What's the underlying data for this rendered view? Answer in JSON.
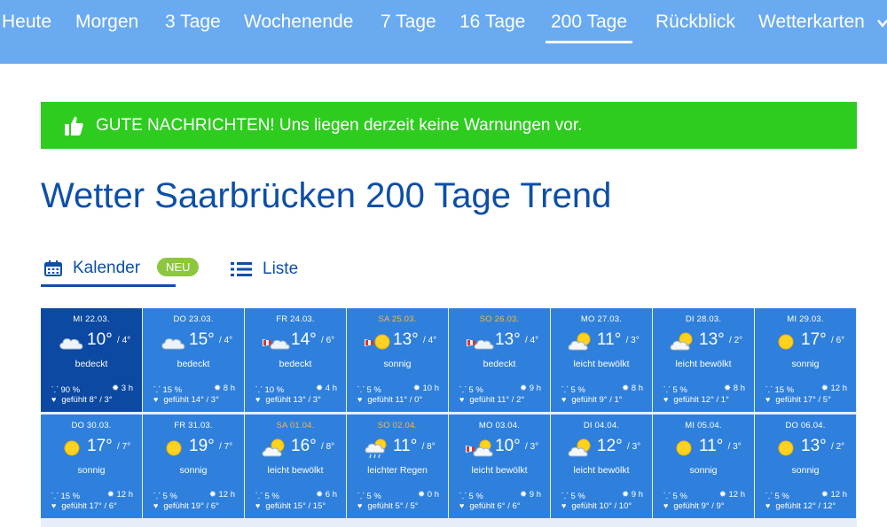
{
  "nav": {
    "items": [
      "Heute",
      "Morgen",
      "3 Tage",
      "Wochenende",
      "7 Tage",
      "16 Tage",
      "200 Tage",
      "Rückblick",
      "Wetterkarten"
    ],
    "active": "200 Tage"
  },
  "alert": {
    "message": "GUTE NACHRICHTEN! Uns liegen derzeit keine Warnungen vor."
  },
  "page": {
    "title": "Wetter Saarbrücken 200 Tage Trend"
  },
  "tabs": {
    "calendar": "Kalender",
    "calendar_badge": "NEU",
    "list": "Liste"
  },
  "colors": {
    "nav_bg": "#6aaaf0",
    "alert_bg": "#2ecc1f",
    "title": "#0d4fa8",
    "cell": "#2f80dc",
    "cell_today": "#0b49a3",
    "weekend_date": "#ffb53a"
  },
  "days": [
    {
      "date": "MI 22.03.",
      "weekend": false,
      "today": true,
      "icon": "cloudy-icon",
      "temp": "10°",
      "min": "/ 4°",
      "cond": "bedeckt",
      "rain": "90 %",
      "sun": "3 h",
      "felt": "gefühlt 8° / 3°"
    },
    {
      "date": "DO 23.03.",
      "weekend": false,
      "today": false,
      "icon": "cloudy-icon",
      "temp": "15°",
      "min": "/ 4°",
      "cond": "bedeckt",
      "rain": "15 %",
      "sun": "8 h",
      "felt": "gefühlt 14° / 3°"
    },
    {
      "date": "FR 24.03.",
      "weekend": false,
      "today": false,
      "icon": "windy-cloudy-icon",
      "temp": "14°",
      "min": "/ 6°",
      "cond": "bedeckt",
      "rain": "10 %",
      "sun": "4 h",
      "felt": "gefühlt 13° / 3°"
    },
    {
      "date": "SA 25.03.",
      "weekend": true,
      "today": false,
      "icon": "windy-sunny-icon",
      "temp": "13°",
      "min": "/ 4°",
      "cond": "sonnig",
      "rain": "5 %",
      "sun": "10 h",
      "felt": "gefühlt 11° / 0°"
    },
    {
      "date": "SO 26.03.",
      "weekend": true,
      "today": false,
      "icon": "windy-cloudy-icon",
      "temp": "13°",
      "min": "/ 4°",
      "cond": "bedeckt",
      "rain": "5 %",
      "sun": "9 h",
      "felt": "gefühlt 11° / 2°"
    },
    {
      "date": "MO 27.03.",
      "weekend": false,
      "today": false,
      "icon": "partly-cloudy-icon",
      "temp": "11°",
      "min": "/ 3°",
      "cond": "leicht bewölkt",
      "rain": "5 %",
      "sun": "8 h",
      "felt": "gefühlt 9° / 1°"
    },
    {
      "date": "DI 28.03.",
      "weekend": false,
      "today": false,
      "icon": "partly-cloudy-icon",
      "temp": "13°",
      "min": "/ 2°",
      "cond": "leicht bewölkt",
      "rain": "5 %",
      "sun": "8 h",
      "felt": "gefühlt 12° / 1°"
    },
    {
      "date": "MI 29.03.",
      "weekend": false,
      "today": false,
      "icon": "sun-icon",
      "temp": "17°",
      "min": "/ 6°",
      "cond": "sonnig",
      "rain": "15 %",
      "sun": "12 h",
      "felt": "gefühlt 17° / 5°"
    },
    {
      "date": "DO 30.03.",
      "weekend": false,
      "today": false,
      "icon": "sun-icon",
      "temp": "17°",
      "min": "/ 7°",
      "cond": "sonnig",
      "rain": "15 %",
      "sun": "12 h",
      "felt": "gefühlt 17° / 6°"
    },
    {
      "date": "FR 31.03.",
      "weekend": false,
      "today": false,
      "icon": "sun-icon",
      "temp": "19°",
      "min": "/ 7°",
      "cond": "sonnig",
      "rain": "5 %",
      "sun": "12 h",
      "felt": "gefühlt 19° / 6°"
    },
    {
      "date": "SA 01.04.",
      "weekend": true,
      "today": false,
      "icon": "partly-cloudy-icon",
      "temp": "16°",
      "min": "/ 8°",
      "cond": "leicht bewölkt",
      "rain": "5 %",
      "sun": "6 h",
      "felt": "gefühlt 15° / 15°"
    },
    {
      "date": "SO 02.04.",
      "weekend": true,
      "today": false,
      "icon": "light-rain-icon",
      "temp": "11°",
      "min": "/ 8°",
      "cond": "leichter Regen",
      "rain": "5 %",
      "sun": "0 h",
      "felt": "gefühlt 5° / 5°"
    },
    {
      "date": "MO 03.04.",
      "weekend": false,
      "today": false,
      "icon": "windy-partly-cloudy-icon",
      "temp": "10°",
      "min": "/ 3°",
      "cond": "leicht bewölkt",
      "rain": "5 %",
      "sun": "9 h",
      "felt": "gefühlt 6° / 6°"
    },
    {
      "date": "DI 04.04.",
      "weekend": false,
      "today": false,
      "icon": "partly-cloudy-icon",
      "temp": "12°",
      "min": "/ 3°",
      "cond": "leicht bewölkt",
      "rain": "5 %",
      "sun": "9 h",
      "felt": "gefühlt 10° / 10°"
    },
    {
      "date": "MI 05.04.",
      "weekend": false,
      "today": false,
      "icon": "sun-icon",
      "temp": "11°",
      "min": "/ 3°",
      "cond": "sonnig",
      "rain": "5 %",
      "sun": "12 h",
      "felt": "gefühlt 9° / 9°"
    },
    {
      "date": "DO 06.04.",
      "weekend": false,
      "today": false,
      "icon": "sun-icon",
      "temp": "13°",
      "min": "/ 2°",
      "cond": "sonnig",
      "rain": "5 %",
      "sun": "12 h",
      "felt": "gefühlt 12° / 12°"
    }
  ]
}
